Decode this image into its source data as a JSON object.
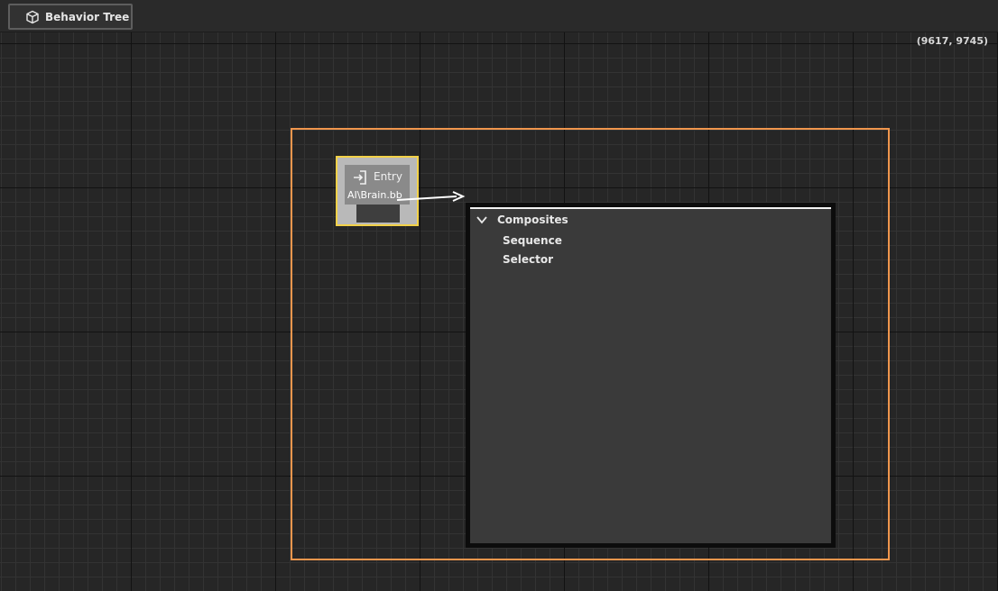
{
  "toolbar": {
    "tab_label": "Behavior Tree",
    "tab_icon": "cube-icon"
  },
  "graph": {
    "coordinates": "(9617, 9745)",
    "selection_color": "#f0964d",
    "entry_node": {
      "title": "Entry",
      "subtitle": "AI\\Brain.bb",
      "icon": "enter-icon",
      "highlight_color": "#f2d148"
    },
    "create_menu": {
      "category": "Composites",
      "items": [
        "Sequence",
        "Selector"
      ]
    }
  }
}
